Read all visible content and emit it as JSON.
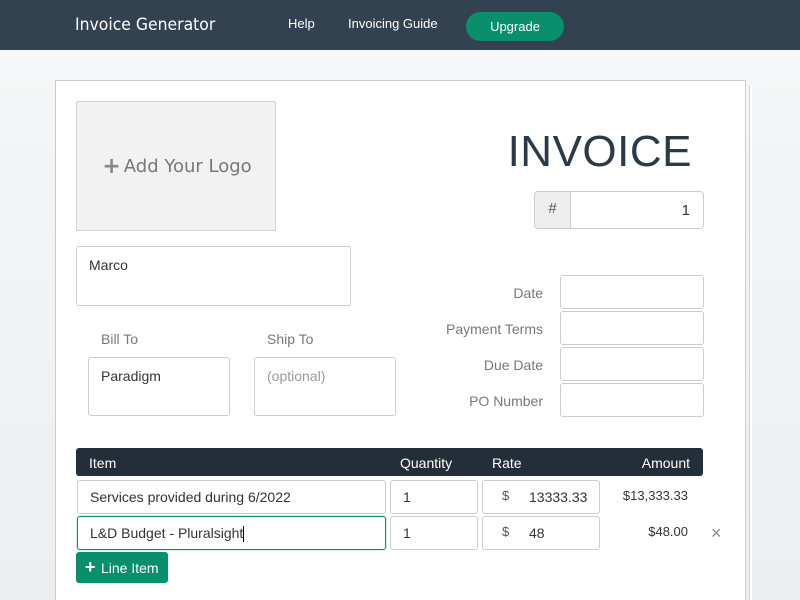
{
  "nav": {
    "brand": "Invoice Generator",
    "help": "Help",
    "guide": "Invoicing Guide",
    "upgrade": "Upgrade"
  },
  "header": {
    "logo_label": "Add Your Logo",
    "title": "INVOICE",
    "number_prefix": "#",
    "number_value": "1"
  },
  "parties": {
    "from_value": "Marco",
    "bill_to_label": "Bill To",
    "bill_to_value": "Paradigm",
    "ship_to_label": "Ship To",
    "ship_to_placeholder": "(optional)"
  },
  "meta": {
    "date_label": "Date",
    "terms_label": "Payment Terms",
    "due_label": "Due Date",
    "po_label": "PO Number"
  },
  "table": {
    "headers": {
      "item": "Item",
      "quantity": "Quantity",
      "rate": "Rate",
      "amount": "Amount"
    },
    "rows": [
      {
        "item": "Services provided during 6/2022",
        "quantity": "1",
        "currency": "$",
        "rate": "13333.33",
        "amount": "$13,333.33"
      },
      {
        "item": "L&D Budget - Pluralsight",
        "quantity": "1",
        "currency": "$",
        "rate": "48",
        "amount": "$48.00"
      }
    ],
    "remove_symbol": "×",
    "add_line_label": "Line Item"
  },
  "colors": {
    "nav_bg": "#334250",
    "accent_green": "#0a8f6c",
    "table_header_bg": "#232e38"
  }
}
